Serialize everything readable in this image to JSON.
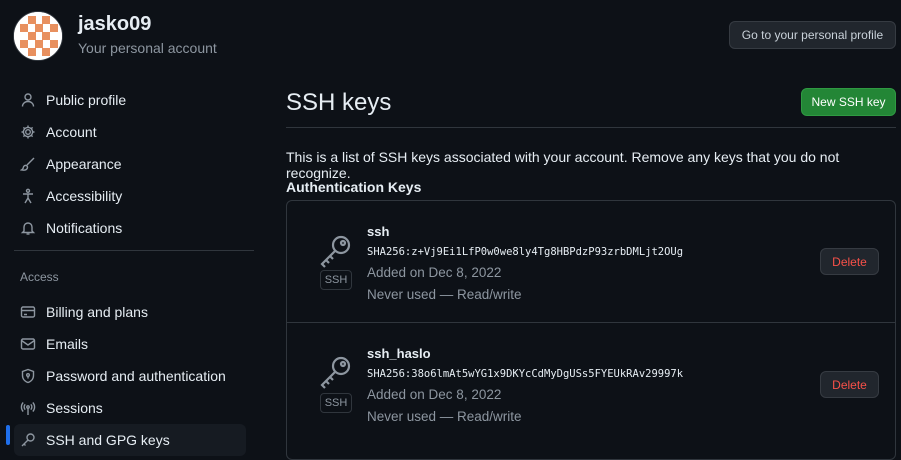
{
  "account": {
    "username": "jasko09",
    "subtitle": "Your personal account",
    "profile_button": "Go to your personal profile"
  },
  "sidebar": {
    "items": [
      {
        "label": "Public profile",
        "icon": "person-icon"
      },
      {
        "label": "Account",
        "icon": "gear-icon"
      },
      {
        "label": "Appearance",
        "icon": "paintbrush-icon"
      },
      {
        "label": "Accessibility",
        "icon": "accessibility-icon"
      },
      {
        "label": "Notifications",
        "icon": "bell-icon"
      }
    ],
    "access_label": "Access",
    "access_items": [
      {
        "label": "Billing and plans",
        "icon": "credit-card-icon"
      },
      {
        "label": "Emails",
        "icon": "mail-icon"
      },
      {
        "label": "Password and authentication",
        "icon": "shield-lock-icon"
      },
      {
        "label": "Sessions",
        "icon": "broadcast-icon"
      },
      {
        "label": "SSH and GPG keys",
        "icon": "key-icon",
        "active": true
      }
    ]
  },
  "main": {
    "title": "SSH keys",
    "new_button": "New SSH key",
    "description": "This is a list of SSH keys associated with your account. Remove any keys that you do not recognize.",
    "section_heading": "Authentication Keys",
    "keys": [
      {
        "title": "ssh",
        "fingerprint": "SHA256:z+Vj9Ei1LfP0w0we8ly4Tg8HBPdzP93zrbDMLjt2OUg",
        "added": "Added on Dec 8, 2022",
        "usage": "Never used — Read/write",
        "badge": "SSH",
        "delete_label": "Delete"
      },
      {
        "title": "ssh_haslo",
        "fingerprint": "SHA256:38o6lmAt5wYG1x9DKYcCdMyDgUSs5FYEUkRAv29997k",
        "added": "Added on Dec 8, 2022",
        "usage": "Never used — Read/write",
        "badge": "SSH",
        "delete_label": "Delete"
      }
    ]
  },
  "colors": {
    "background": "#0d1117",
    "primary_button": "#238636",
    "danger_text": "#f85149",
    "active_indicator": "#1f6feb",
    "avatar_accent": "#e8905f"
  }
}
